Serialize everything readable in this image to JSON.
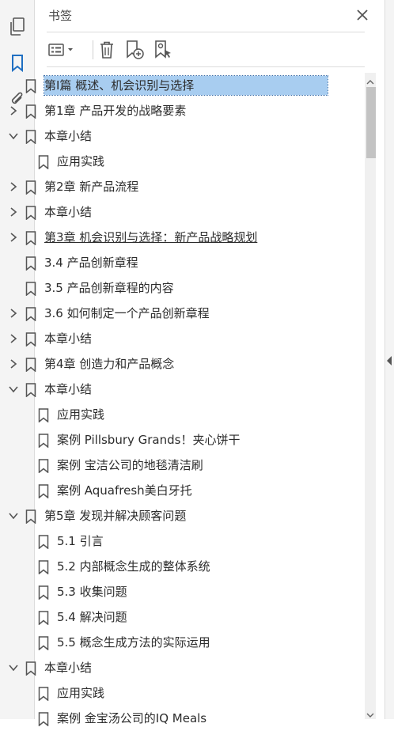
{
  "panel": {
    "title": "书签"
  },
  "icons": {
    "sidebar": [
      "pages-icon",
      "bookmark-icon",
      "attachment-icon"
    ],
    "toolbar": [
      "options-menu-icon",
      "delete-bookmark-icon",
      "new-bookmark-icon",
      "new-bookmark-from-structure-icon"
    ]
  },
  "colors": {
    "selection": "#a8cdf0",
    "accent": "#1f6fc2"
  },
  "bookmarks": [
    {
      "label": "第Ⅰ篇  概述、机会识别与选择",
      "level": 0,
      "expander": "none",
      "selected": true
    },
    {
      "label": "第1章  产品开发的战略要素",
      "level": 0,
      "expander": "collapsed"
    },
    {
      "label": "本章小结",
      "level": 0,
      "expander": "expanded"
    },
    {
      "label": "应用实践",
      "level": 1,
      "expander": "none"
    },
    {
      "label": "第2章  新产品流程",
      "level": 0,
      "expander": "collapsed"
    },
    {
      "label": "本章小结",
      "level": 0,
      "expander": "collapsed"
    },
    {
      "label": "第3章  机会识别与选择：新产品战略规划",
      "level": 0,
      "expander": "collapsed",
      "underline": true
    },
    {
      "label": "3.4  产品创新章程",
      "level": 0,
      "expander": "none"
    },
    {
      "label": "3.5  产品创新章程的内容",
      "level": 0,
      "expander": "none"
    },
    {
      "label": "3.6  如何制定一个产品创新章程",
      "level": 0,
      "expander": "collapsed"
    },
    {
      "label": "本章小结",
      "level": 0,
      "expander": "collapsed"
    },
    {
      "label": "第4章  创造力和产品概念",
      "level": 0,
      "expander": "collapsed"
    },
    {
      "label": "本章小结",
      "level": 0,
      "expander": "expanded"
    },
    {
      "label": "应用实践",
      "level": 1,
      "expander": "none"
    },
    {
      "label": "案例  Pillsbury Grands！夹心饼干",
      "level": 1,
      "expander": "none"
    },
    {
      "label": "案例  宝洁公司的地毯清洁刷",
      "level": 1,
      "expander": "none"
    },
    {
      "label": "案例  Aquafresh美白牙托",
      "level": 1,
      "expander": "none"
    },
    {
      "label": "第5章  发现并解决顾客问题",
      "level": 0,
      "expander": "expanded"
    },
    {
      "label": "5.1  引言",
      "level": 1,
      "expander": "none"
    },
    {
      "label": "5.2  内部概念生成的整体系统",
      "level": 1,
      "expander": "none"
    },
    {
      "label": "5.3  收集问题",
      "level": 1,
      "expander": "none"
    },
    {
      "label": "5.4  解决问题",
      "level": 1,
      "expander": "none"
    },
    {
      "label": "5.5  概念生成方法的实际运用",
      "level": 1,
      "expander": "none"
    },
    {
      "label": "本章小结",
      "level": 0,
      "expander": "expanded"
    },
    {
      "label": "应用实践",
      "level": 1,
      "expander": "none"
    },
    {
      "label": "案例  金宝汤公司的IQ Meals",
      "level": 1,
      "expander": "none"
    }
  ]
}
